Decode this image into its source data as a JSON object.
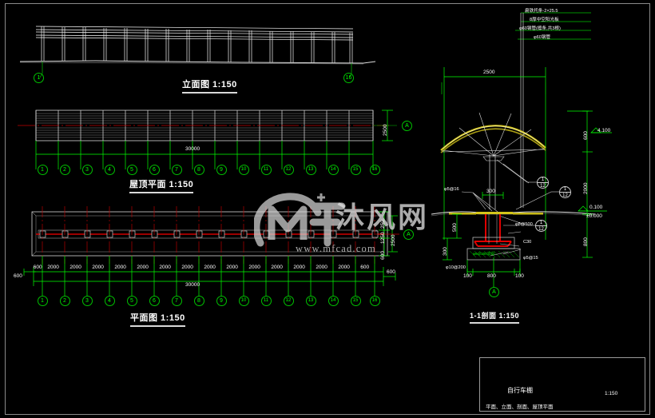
{
  "sheet": {
    "background": "#000000",
    "line_white": "#ffffff",
    "line_green": "#00ff00",
    "line_red": "#ff0000",
    "line_yellow": "#d4c51a",
    "border_gray": "#8a8a8a"
  },
  "views": {
    "elevation": {
      "title": "立面图 1:150",
      "left_bubble": "1",
      "right_bubble": "16"
    },
    "roof_plan": {
      "title": "屋顶平面 1:150",
      "overall_dim": "30000",
      "side_dim": "2500",
      "side_bubble": "A",
      "bubbles": [
        "1",
        "2",
        "3",
        "4",
        "5",
        "6",
        "7",
        "8",
        "9",
        "10",
        "11",
        "12",
        "13",
        "14",
        "15",
        "16"
      ]
    },
    "plan": {
      "title": "平面图 1:150",
      "overall_dim": "30000",
      "bay_dims": [
        "600",
        "2000",
        "2000",
        "2000",
        "2000",
        "2000",
        "2000",
        "2000",
        "2000",
        "2000",
        "2000",
        "2000",
        "2000",
        "2000",
        "2000",
        "600"
      ],
      "end_offset_left": "600",
      "end_offset_right": "600",
      "vertical_dims": [
        "600",
        "1250",
        "250"
      ],
      "vertical_total": "2500",
      "side_bubble": "A",
      "bubbles": [
        "1",
        "2",
        "3",
        "4",
        "5",
        "6",
        "7",
        "8",
        "9",
        "10",
        "11",
        "12",
        "13",
        "14",
        "15",
        "16"
      ]
    },
    "section": {
      "title": "1-1剖面 1:150",
      "span_dim": "2500",
      "height_dims": [
        "600",
        "2000"
      ],
      "grid_bubble": "A",
      "elev_top": "4.100",
      "elev_ground_1": "0.100",
      "elev_ground_2": "±0.000",
      "roof_notes": [
        "扁铁托条-2×25.5",
        "8厚中空阳光板",
        "φ60钢管(檩条,共3根)",
        "φ60钢管"
      ],
      "foundation_notes": {
        "rebar_top": "φ5@16",
        "column_dim": "300",
        "stirrup": "φ8@500",
        "concrete": "C30",
        "rebar_bottom": "φ5@15",
        "slab_note": "φ10@200",
        "mesh_note": "φ6@200双向"
      },
      "foundation_dims": {
        "left_upper": "500",
        "left_lower": "300",
        "right_upper": "800",
        "bottom": [
          "100",
          "800",
          "100"
        ]
      },
      "detail_bubbles": [
        {
          "top": "1",
          "bottom": "12"
        },
        {
          "top": "1",
          "bottom": "12"
        },
        {
          "top": "1",
          "bottom": "12"
        }
      ]
    }
  },
  "title_block": {
    "project": "自行车棚",
    "drawing_list": "平面、立面、剖面、屋顶平面",
    "scale": "1:150"
  },
  "watermark": {
    "brand_cn": "沐风网",
    "url": "www.mfcad.com",
    "logo": "mf-logo-icon"
  }
}
